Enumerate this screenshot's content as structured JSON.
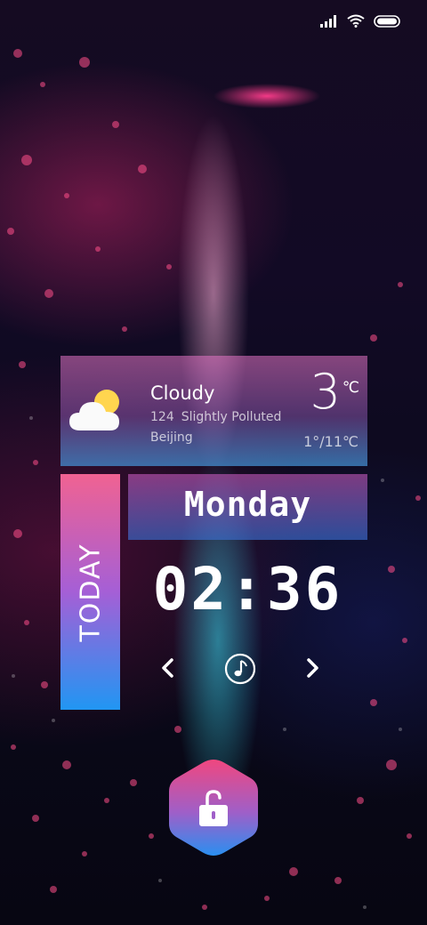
{
  "status_bar": {
    "icons": [
      "signal-icon",
      "wifi-icon",
      "battery-icon"
    ]
  },
  "weather": {
    "icon": "partly-cloudy-icon",
    "condition": "Cloudy",
    "aqi_value": "124",
    "aqi_text": "Slightly Polluted",
    "city": "Beijing",
    "temperature": "3",
    "unit": "℃",
    "range": "1°/11℃"
  },
  "today_label": "TODAY",
  "day_of_week": "Monday",
  "time": "02:36",
  "music": {
    "prev_icon": "chevron-left-icon",
    "play_icon": "music-note-icon",
    "next_icon": "chevron-right-icon"
  },
  "unlock": {
    "icon": "unlock-icon"
  },
  "colors": {
    "today_gradient_top": "#f06292",
    "today_gradient_bottom": "#2196f3",
    "unlock_gradient_top": "#f0477f",
    "unlock_gradient_bottom": "#2a8ff0"
  }
}
